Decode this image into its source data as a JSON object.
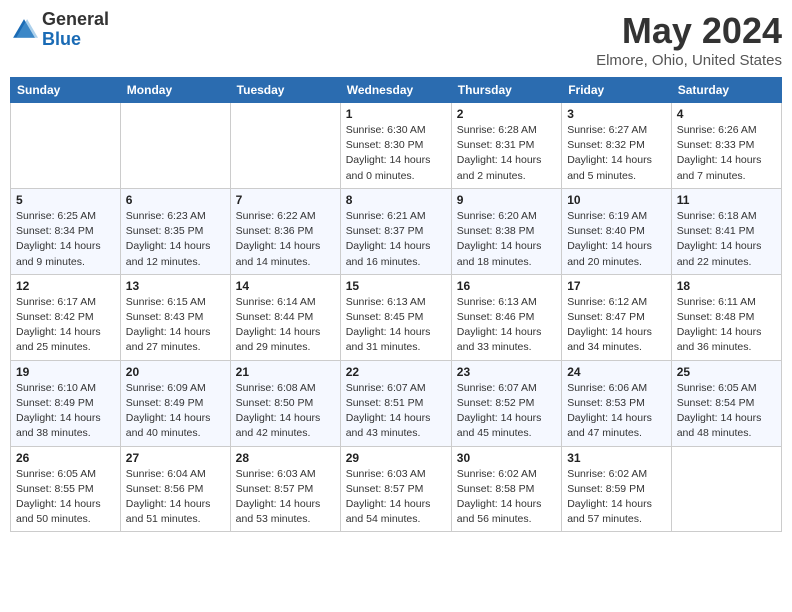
{
  "logo": {
    "general": "General",
    "blue": "Blue"
  },
  "header": {
    "month": "May 2024",
    "location": "Elmore, Ohio, United States"
  },
  "weekdays": [
    "Sunday",
    "Monday",
    "Tuesday",
    "Wednesday",
    "Thursday",
    "Friday",
    "Saturday"
  ],
  "weeks": [
    [
      {
        "day": "",
        "info": ""
      },
      {
        "day": "",
        "info": ""
      },
      {
        "day": "",
        "info": ""
      },
      {
        "day": "1",
        "info": "Sunrise: 6:30 AM\nSunset: 8:30 PM\nDaylight: 14 hours\nand 0 minutes."
      },
      {
        "day": "2",
        "info": "Sunrise: 6:28 AM\nSunset: 8:31 PM\nDaylight: 14 hours\nand 2 minutes."
      },
      {
        "day": "3",
        "info": "Sunrise: 6:27 AM\nSunset: 8:32 PM\nDaylight: 14 hours\nand 5 minutes."
      },
      {
        "day": "4",
        "info": "Sunrise: 6:26 AM\nSunset: 8:33 PM\nDaylight: 14 hours\nand 7 minutes."
      }
    ],
    [
      {
        "day": "5",
        "info": "Sunrise: 6:25 AM\nSunset: 8:34 PM\nDaylight: 14 hours\nand 9 minutes."
      },
      {
        "day": "6",
        "info": "Sunrise: 6:23 AM\nSunset: 8:35 PM\nDaylight: 14 hours\nand 12 minutes."
      },
      {
        "day": "7",
        "info": "Sunrise: 6:22 AM\nSunset: 8:36 PM\nDaylight: 14 hours\nand 14 minutes."
      },
      {
        "day": "8",
        "info": "Sunrise: 6:21 AM\nSunset: 8:37 PM\nDaylight: 14 hours\nand 16 minutes."
      },
      {
        "day": "9",
        "info": "Sunrise: 6:20 AM\nSunset: 8:38 PM\nDaylight: 14 hours\nand 18 minutes."
      },
      {
        "day": "10",
        "info": "Sunrise: 6:19 AM\nSunset: 8:40 PM\nDaylight: 14 hours\nand 20 minutes."
      },
      {
        "day": "11",
        "info": "Sunrise: 6:18 AM\nSunset: 8:41 PM\nDaylight: 14 hours\nand 22 minutes."
      }
    ],
    [
      {
        "day": "12",
        "info": "Sunrise: 6:17 AM\nSunset: 8:42 PM\nDaylight: 14 hours\nand 25 minutes."
      },
      {
        "day": "13",
        "info": "Sunrise: 6:15 AM\nSunset: 8:43 PM\nDaylight: 14 hours\nand 27 minutes."
      },
      {
        "day": "14",
        "info": "Sunrise: 6:14 AM\nSunset: 8:44 PM\nDaylight: 14 hours\nand 29 minutes."
      },
      {
        "day": "15",
        "info": "Sunrise: 6:13 AM\nSunset: 8:45 PM\nDaylight: 14 hours\nand 31 minutes."
      },
      {
        "day": "16",
        "info": "Sunrise: 6:13 AM\nSunset: 8:46 PM\nDaylight: 14 hours\nand 33 minutes."
      },
      {
        "day": "17",
        "info": "Sunrise: 6:12 AM\nSunset: 8:47 PM\nDaylight: 14 hours\nand 34 minutes."
      },
      {
        "day": "18",
        "info": "Sunrise: 6:11 AM\nSunset: 8:48 PM\nDaylight: 14 hours\nand 36 minutes."
      }
    ],
    [
      {
        "day": "19",
        "info": "Sunrise: 6:10 AM\nSunset: 8:49 PM\nDaylight: 14 hours\nand 38 minutes."
      },
      {
        "day": "20",
        "info": "Sunrise: 6:09 AM\nSunset: 8:49 PM\nDaylight: 14 hours\nand 40 minutes."
      },
      {
        "day": "21",
        "info": "Sunrise: 6:08 AM\nSunset: 8:50 PM\nDaylight: 14 hours\nand 42 minutes."
      },
      {
        "day": "22",
        "info": "Sunrise: 6:07 AM\nSunset: 8:51 PM\nDaylight: 14 hours\nand 43 minutes."
      },
      {
        "day": "23",
        "info": "Sunrise: 6:07 AM\nSunset: 8:52 PM\nDaylight: 14 hours\nand 45 minutes."
      },
      {
        "day": "24",
        "info": "Sunrise: 6:06 AM\nSunset: 8:53 PM\nDaylight: 14 hours\nand 47 minutes."
      },
      {
        "day": "25",
        "info": "Sunrise: 6:05 AM\nSunset: 8:54 PM\nDaylight: 14 hours\nand 48 minutes."
      }
    ],
    [
      {
        "day": "26",
        "info": "Sunrise: 6:05 AM\nSunset: 8:55 PM\nDaylight: 14 hours\nand 50 minutes."
      },
      {
        "day": "27",
        "info": "Sunrise: 6:04 AM\nSunset: 8:56 PM\nDaylight: 14 hours\nand 51 minutes."
      },
      {
        "day": "28",
        "info": "Sunrise: 6:03 AM\nSunset: 8:57 PM\nDaylight: 14 hours\nand 53 minutes."
      },
      {
        "day": "29",
        "info": "Sunrise: 6:03 AM\nSunset: 8:57 PM\nDaylight: 14 hours\nand 54 minutes."
      },
      {
        "day": "30",
        "info": "Sunrise: 6:02 AM\nSunset: 8:58 PM\nDaylight: 14 hours\nand 56 minutes."
      },
      {
        "day": "31",
        "info": "Sunrise: 6:02 AM\nSunset: 8:59 PM\nDaylight: 14 hours\nand 57 minutes."
      },
      {
        "day": "",
        "info": ""
      }
    ]
  ]
}
